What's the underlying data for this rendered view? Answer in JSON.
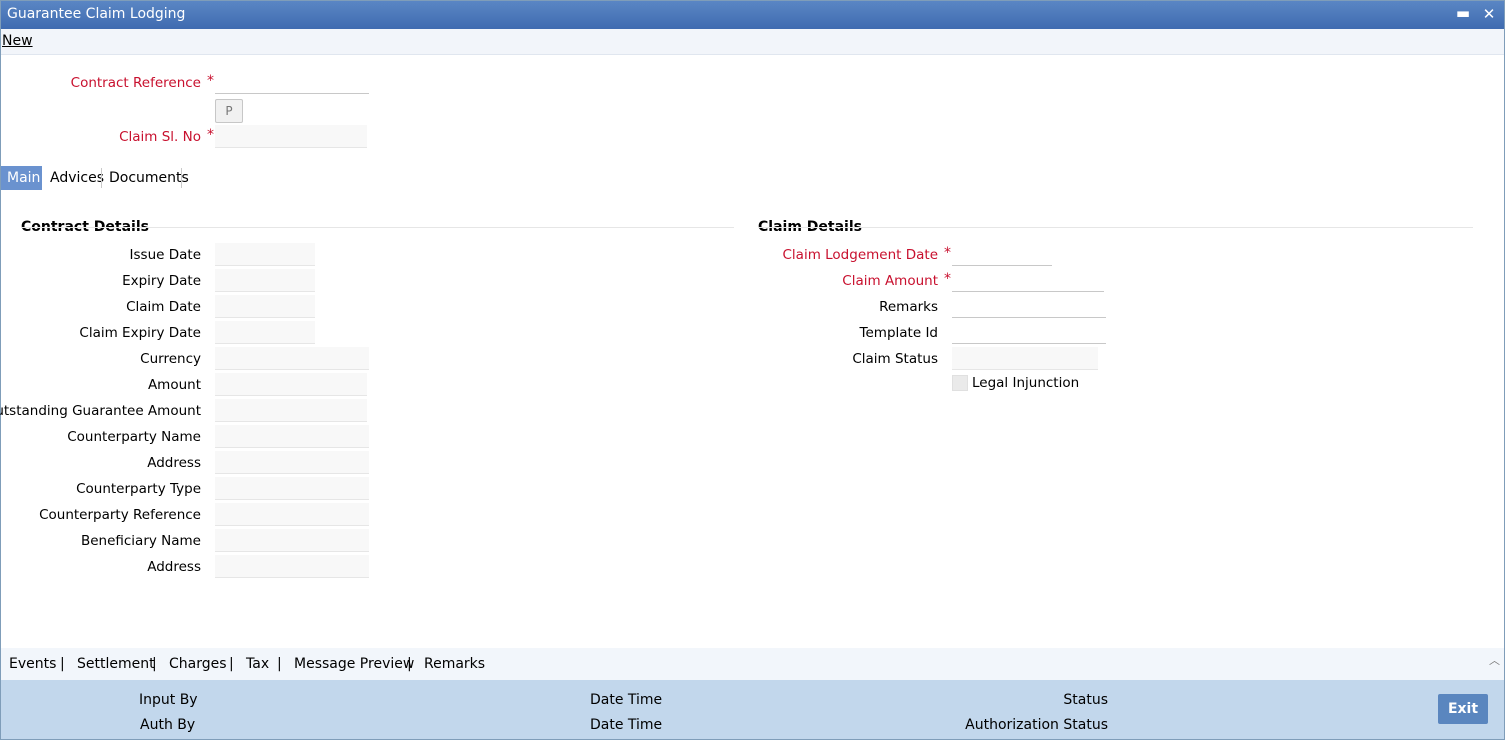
{
  "window": {
    "title": "Guarantee Claim Lodging",
    "minimize": "▬",
    "close": "✕"
  },
  "menu": {
    "new_label": "New"
  },
  "header": {
    "contract_reference_label": "Contract Reference",
    "p_button": "P",
    "claim_sl_no_label": "Claim Sl. No",
    "required_mark": "*"
  },
  "tabs": [
    {
      "label": "Main"
    },
    {
      "label": "Advices"
    },
    {
      "label": "Documents"
    }
  ],
  "contract_details": {
    "title": "Contract Details",
    "fields": [
      "Issue Date",
      "Expiry Date",
      "Claim Date",
      "Claim Expiry Date",
      "Currency",
      "Amount",
      "Outstanding Guarantee Amount",
      "Counterparty Name",
      "Address",
      "Counterparty Type",
      "Counterparty Reference",
      "Beneficiary Name",
      "Address"
    ]
  },
  "claim_details": {
    "title": "Claim Details",
    "claim_lodgement_date": "Claim Lodgement Date",
    "claim_amount": "Claim Amount",
    "remarks": "Remarks",
    "template_id": "Template Id",
    "claim_status": "Claim Status",
    "legal_injunction": "Legal Injunction"
  },
  "bottom_tabs": [
    {
      "label": "Events"
    },
    {
      "label": "Settlement"
    },
    {
      "label": "Charges"
    },
    {
      "label": "Tax"
    },
    {
      "label": "Message Preview"
    },
    {
      "label": "Remarks"
    }
  ],
  "bottom_sep": "|",
  "footer": {
    "input_by": "Input By",
    "auth_by": "Auth By",
    "date_time": "Date Time",
    "status": "Status",
    "authorization_status": "Authorization Status",
    "exit_label": "Exit"
  },
  "colors": {
    "title_bar": "#3f6bb0",
    "required": "#c8102e",
    "footer": "#c2d7ec",
    "active_tab": "#6a92cf"
  }
}
